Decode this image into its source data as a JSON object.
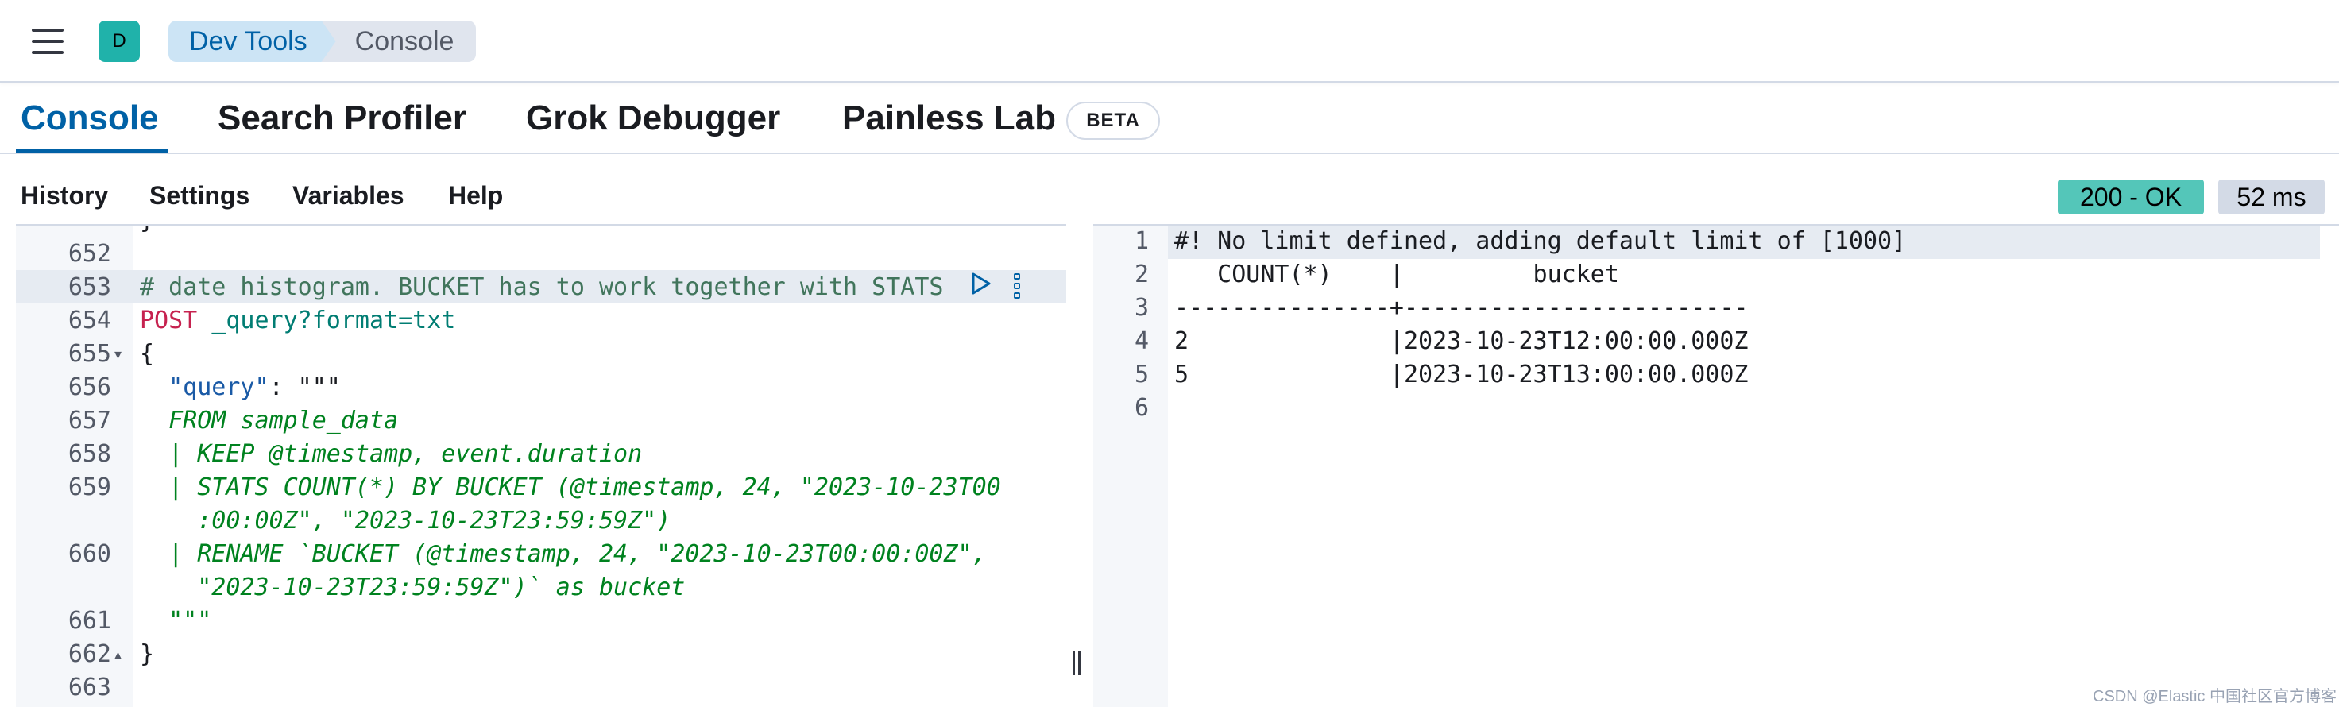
{
  "header": {
    "logo_letter": "D",
    "breadcrumbs": [
      "Dev Tools",
      "Console"
    ]
  },
  "tabs": [
    {
      "label": "Console",
      "active": true
    },
    {
      "label": "Search Profiler",
      "active": false
    },
    {
      "label": "Grok Debugger",
      "active": false
    },
    {
      "label": "Painless Lab",
      "active": false
    }
  ],
  "beta_badge": "BETA",
  "toolbar": {
    "history": "History",
    "settings": "Settings",
    "variables": "Variables",
    "help": "Help",
    "status": "200 - OK",
    "duration": "52 ms"
  },
  "request_editor": {
    "lines": [
      {
        "num": "652",
        "text": ""
      },
      {
        "num": "653",
        "text": "# date histogram. BUCKET has to work together with STATS"
      },
      {
        "num": "654",
        "method": "POST",
        "url": "_query?format=txt"
      },
      {
        "num": "655",
        "text": "{"
      },
      {
        "num": "656",
        "key": "\"query\"",
        "rest": ": \"\"\""
      },
      {
        "num": "657",
        "text": "  FROM sample_data"
      },
      {
        "num": "658",
        "text": "  | KEEP @timestamp, event.duration"
      },
      {
        "num": "659",
        "text": "  | STATS COUNT(*) BY BUCKET (@timestamp, 24, \"2023-10-23T00"
      },
      {
        "num": "",
        "text": "    :00:00Z\", \"2023-10-23T23:59:59Z\")"
      },
      {
        "num": "660",
        "text": "  | RENAME `BUCKET (@timestamp, 24, \"2023-10-23T00:00:00Z\","
      },
      {
        "num": "",
        "text": "    \"2023-10-23T23:59:59Z\")` as bucket"
      },
      {
        "num": "661",
        "text": "  \"\"\""
      },
      {
        "num": "662",
        "text": "}"
      },
      {
        "num": "663",
        "text": ""
      }
    ]
  },
  "response_editor": {
    "lines": [
      {
        "num": "1",
        "text": "#! No limit defined, adding default limit of [1000]"
      },
      {
        "num": "2",
        "text": "   COUNT(*)    |         bucket"
      },
      {
        "num": "3",
        "text": "---------------+------------------------"
      },
      {
        "num": "4",
        "text": "2              |2023-10-23T12:00:00.000Z"
      },
      {
        "num": "5",
        "text": "5              |2023-10-23T13:00:00.000Z"
      },
      {
        "num": "6",
        "text": ""
      }
    ]
  },
  "watermark": "CSDN @Elastic 中国社区官方博客",
  "colors": {
    "accent": "#0061a6",
    "status_ok": "#54c6b9",
    "logo": "#20b2aa"
  }
}
